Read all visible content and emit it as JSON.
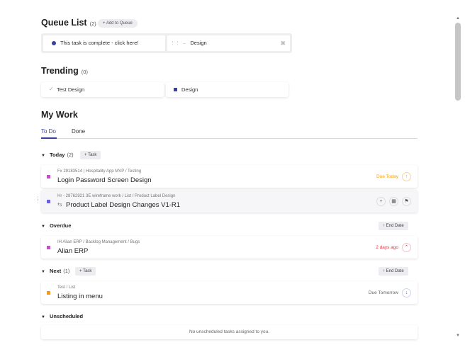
{
  "queue": {
    "title": "Queue List",
    "count": "(2)",
    "add_label": "+ Add to Queue",
    "items": [
      {
        "label": "This task is complete - click here!",
        "color": "#3a3f9e"
      },
      {
        "label": "Design",
        "color": "#3a3f9e"
      }
    ]
  },
  "trending": {
    "title": "Trending",
    "count": "(0)",
    "items": [
      {
        "label": "Test Design"
      },
      {
        "label": "Design",
        "color": "#3a3f9e"
      }
    ]
  },
  "mywork": {
    "title": "My Work",
    "tabs": [
      {
        "label": "To Do",
        "active": true
      },
      {
        "label": "Done",
        "active": false
      }
    ],
    "groups": {
      "today": {
        "label": "Today",
        "count": "(2)",
        "add_label": "+ Task",
        "tasks": [
          {
            "path": "Fx 29183514 | Hospitality App MVP / Testing",
            "name": "Login Password Screen Design",
            "due": "Due Today",
            "color": "#c94cc9",
            "due_color": "#f0a21a"
          },
          {
            "path": "Hr - 28762921 3E wireframe work / List / Product Label Design",
            "name": "Product Label Design Changes V1-R1",
            "color": "#6a63d6"
          }
        ]
      },
      "overdue": {
        "label": "Overdue",
        "sort_label": "↑ End Date",
        "tasks": [
          {
            "path": "IH Alian ERP / Backlog Management / Bugs",
            "name": "Alian ERP",
            "due": "2 days ago",
            "color": "#c94cc9",
            "due_color": "#e23a4a"
          }
        ]
      },
      "next": {
        "label": "Next",
        "count": "(1)",
        "add_label": "+ Task",
        "sort_label": "↑ End Date",
        "tasks": [
          {
            "path": "Test / List",
            "name": "Listing in menu",
            "due": "Due Tomorrow",
            "color": "#f59a1f",
            "due_color": "#666666"
          }
        ]
      },
      "unscheduled": {
        "label": "Unscheduled",
        "empty_text": "No unscheduled tasks assigned to you."
      }
    }
  }
}
